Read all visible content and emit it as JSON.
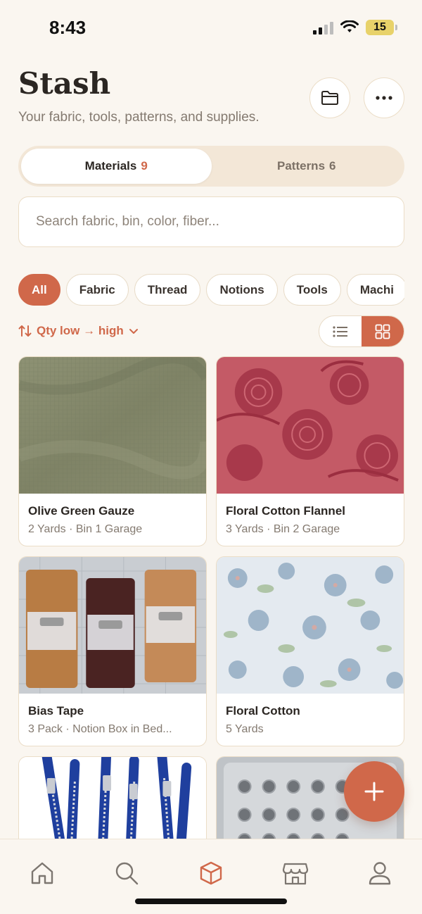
{
  "status": {
    "time": "8:43",
    "battery": "15"
  },
  "header": {
    "title": "Stash",
    "subtitle": "Your fabric, tools, patterns, and supplies."
  },
  "segments": [
    {
      "label": "Materials",
      "count": "9",
      "active": true
    },
    {
      "label": "Patterns",
      "count": "6",
      "active": false
    }
  ],
  "search": {
    "placeholder": "Search fabric, bin, color, fiber..."
  },
  "filters": [
    "All",
    "Fabric",
    "Thread",
    "Notions",
    "Tools",
    "Machi"
  ],
  "sort": {
    "label": "Qty low → high"
  },
  "view": {
    "mode": "grid"
  },
  "items": [
    {
      "name": "Olive Green Gauze",
      "meta": "2 Yards · Bin 1 Garage"
    },
    {
      "name": "Floral Cotton Flannel",
      "meta": "3 Yards · Bin 2 Garage"
    },
    {
      "name": "Bias Tape",
      "meta": "3 Pack · Notion Box in Bed..."
    },
    {
      "name": "Floral Cotton",
      "meta": "5 Yards"
    }
  ],
  "colors": {
    "accent": "#D0684A",
    "background": "#FAF6F0",
    "border": "#EBDDC7"
  },
  "icons": {
    "header": [
      "folder-icon",
      "more-icon"
    ],
    "tabs": [
      "home-icon",
      "search-icon",
      "box-icon",
      "store-icon",
      "profile-icon"
    ],
    "fab": "plus-icon"
  }
}
